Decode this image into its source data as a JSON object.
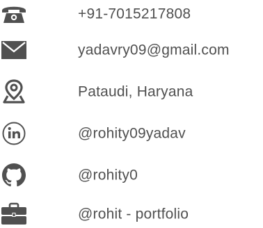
{
  "contacts": {
    "phone": {
      "text": "+91-7015217808",
      "icon": "telephone-icon"
    },
    "email": {
      "text": "yadavry09@gmail.com",
      "icon": "envelope-icon"
    },
    "location": {
      "text": "Pataudi, Haryana",
      "icon": "location-pin-icon"
    },
    "linkedin": {
      "text": "@rohity09yadav",
      "icon": "linkedin-icon"
    },
    "github": {
      "text": "@rohity0",
      "icon": "github-icon"
    },
    "portfolio": {
      "text": "@rohit - portfolio",
      "icon": "briefcase-icon"
    }
  },
  "colors": {
    "icon": "#505050",
    "text": "#505050",
    "background": "#ffffff"
  }
}
